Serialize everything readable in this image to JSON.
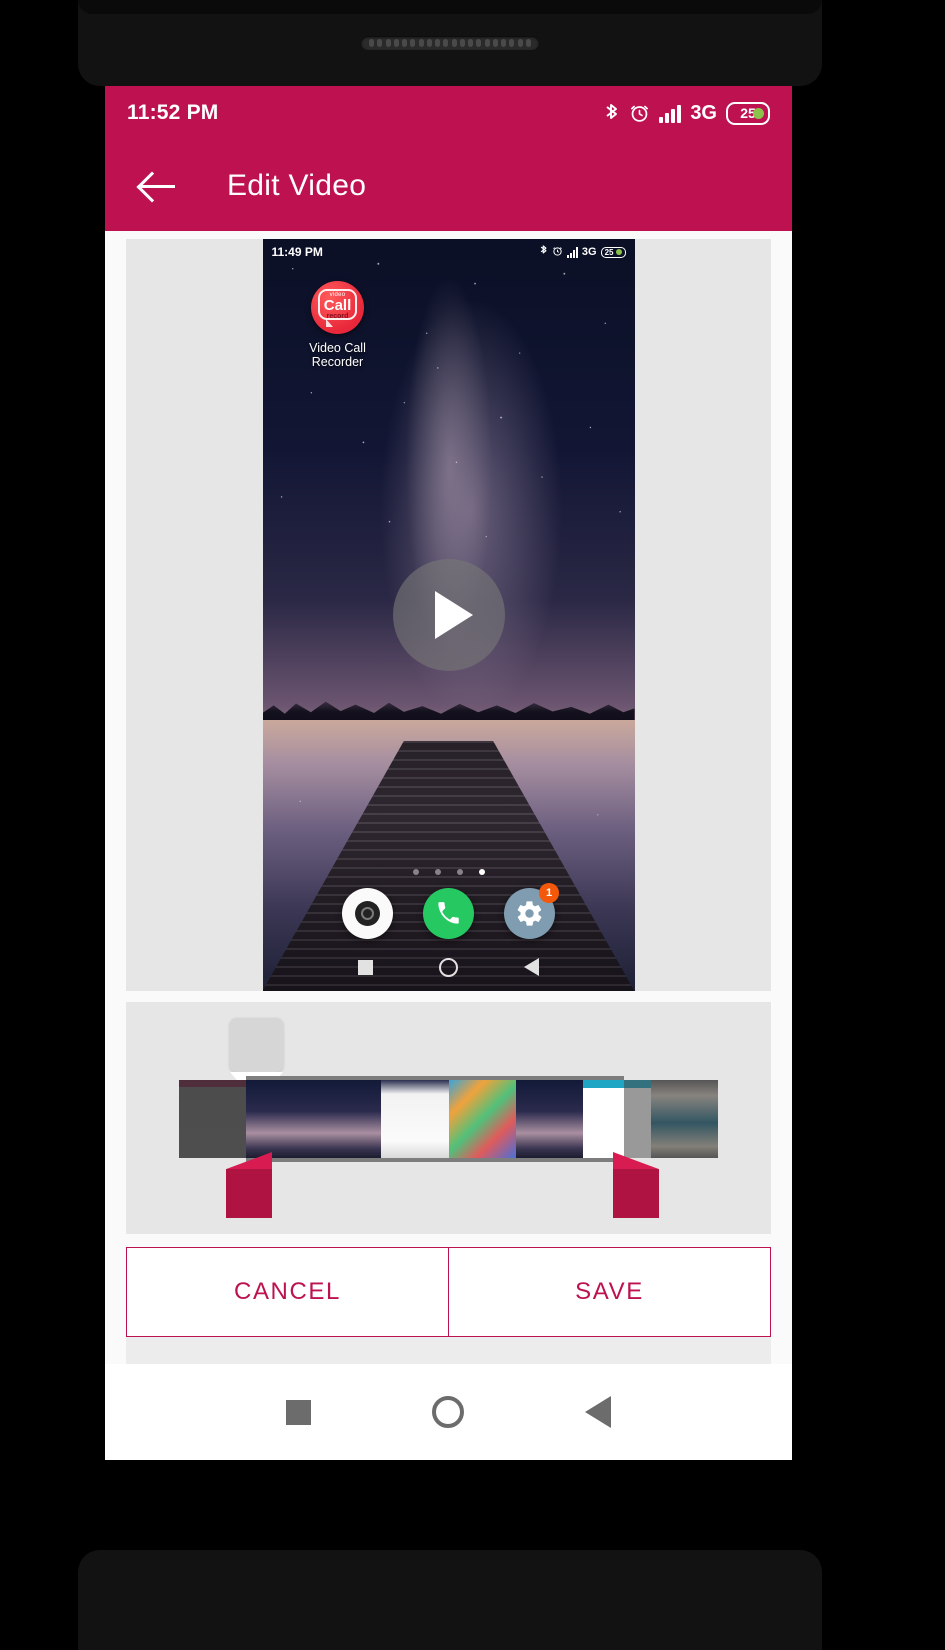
{
  "status_bar": {
    "time": "11:52 PM",
    "network": "3G",
    "battery": "25",
    "icons": [
      "bluetooth-icon",
      "alarm-icon",
      "signal-icon",
      "battery-icon"
    ]
  },
  "app_bar": {
    "back_label": "back-arrow",
    "title": "Edit Video"
  },
  "preview": {
    "video_status_bar": {
      "time": "11:49 PM",
      "network": "3G",
      "battery": "25"
    },
    "shortcut": {
      "icon_top_text": "video",
      "icon_main_text": "Call",
      "icon_bottom_text": "record",
      "label_line1": "Video Call",
      "label_line2": "Recorder"
    },
    "play_button": "play-icon",
    "page_dots": {
      "count": 4,
      "active_index": 3
    },
    "dock": [
      {
        "name": "camera-icon",
        "badge": ""
      },
      {
        "name": "phone-icon",
        "badge": ""
      },
      {
        "name": "settings-gear-icon",
        "badge": "1"
      }
    ],
    "nav": [
      "recents-square-icon",
      "home-circle-icon",
      "back-triangle-icon"
    ]
  },
  "timeline": {
    "frame_count": 8,
    "trim_start_index": 1,
    "trim_end_index": 6,
    "left_handle_label": "trim-start-handle",
    "right_handle_label": "trim-end-handle",
    "playhead_label": "playhead-tooltip"
  },
  "actions": {
    "cancel_label": "CANCEL",
    "save_label": "SAVE"
  },
  "nav_bar": {
    "recents": "recents-square-icon",
    "home": "home-circle-icon",
    "back": "back-triangle-icon"
  },
  "colors": {
    "primary": "#BE1250",
    "accent": "#D81B50",
    "badge": "#F4590B",
    "phone_green": "#26C862",
    "panel_bg": "#E6E6E6"
  }
}
